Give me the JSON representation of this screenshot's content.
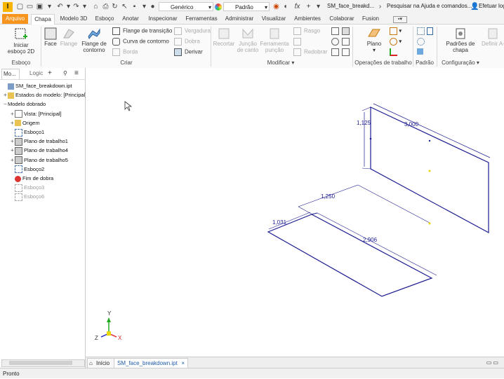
{
  "titlebar": {
    "logo": "I",
    "appearance": "Genérico",
    "style": "Padrão",
    "file_title": "SM_face_breakd...",
    "search": "Pesquisar na Ajuda e comandos...",
    "signin": "Efetuar log"
  },
  "tabs": [
    "Arquivo",
    "Chapa",
    "Modelo 3D",
    "Esboço",
    "Anotar",
    "Inspecionar",
    "Ferramentas",
    "Administrar",
    "Visualizar",
    "Ambientes",
    "Colaborar",
    "Fusion"
  ],
  "ribbon": {
    "sketch": {
      "start": "Iniciar esboço 2D",
      "panel": "Esboço"
    },
    "create": {
      "face": "Face",
      "flange": "Flange",
      "contour_flange": "Flange de contorno",
      "transition_flange": "Flange de transição",
      "contour_curve": "Curva de contorno",
      "border": "Borda",
      "hem": "Vergadura",
      "fold": "Dobra",
      "derive": "Derivar",
      "panel": "Criar"
    },
    "modify": {
      "cut": "Recortar",
      "corner_seam": "Junção de canto",
      "punch_tool": "Ferramenta punção",
      "rip": "Rasgo",
      "refold": "Redobrar",
      "panel": "Modificar"
    },
    "work": {
      "plane": "Plano",
      "panel": "Operações de trabalho"
    },
    "pattern": {
      "panel": "Padrão"
    },
    "setup": {
      "sheet_defaults": "Padrões de chapa",
      "define_aside": "Definir A-Side",
      "panel": "Configuração"
    }
  },
  "browser": {
    "tab_model": "Mo...",
    "tab_logic": "Logic",
    "items": [
      {
        "label": "SM_face_breakdown.ipt",
        "indent": 0,
        "exp": "",
        "dim": false
      },
      {
        "label": "Estados do modelo: [Principal]",
        "indent": 0,
        "exp": "+",
        "dim": false
      },
      {
        "label": "Modelo dobrado",
        "indent": 0,
        "exp": "−",
        "dim": false
      },
      {
        "label": "Vista: [Principal]",
        "indent": 1,
        "exp": "+",
        "dim": false
      },
      {
        "label": "Origem",
        "indent": 1,
        "exp": "+",
        "dim": false
      },
      {
        "label": "Esboço1",
        "indent": 1,
        "exp": "",
        "dim": false
      },
      {
        "label": "Plano de trabalho1",
        "indent": 1,
        "exp": "+",
        "dim": false
      },
      {
        "label": "Plano de trabalho4",
        "indent": 1,
        "exp": "+",
        "dim": false
      },
      {
        "label": "Plano de trabalho5",
        "indent": 1,
        "exp": "+",
        "dim": false
      },
      {
        "label": "Esboço2",
        "indent": 1,
        "exp": "",
        "dim": false
      },
      {
        "label": "Fim de dobra",
        "indent": 1,
        "exp": "",
        "dim": false
      },
      {
        "label": "Esboço3",
        "indent": 1,
        "exp": "",
        "dim": true
      },
      {
        "label": "Esboço6",
        "indent": 1,
        "exp": "",
        "dim": true
      }
    ]
  },
  "canvas": {
    "dims": {
      "d1": "1,125",
      "d2": "3,000",
      "d3": "1,250",
      "d4": "1,031",
      "d5": "2,906"
    },
    "axes": {
      "x": "X",
      "y": "Y",
      "z": "Z"
    }
  },
  "doctabs": {
    "home": "Início",
    "file": "SM_face_breakdown.ipt"
  },
  "status": "Pronto",
  "colors": {
    "accent": "#f7941d",
    "sketch": "#1b1b8f",
    "point": "#e8d800"
  }
}
